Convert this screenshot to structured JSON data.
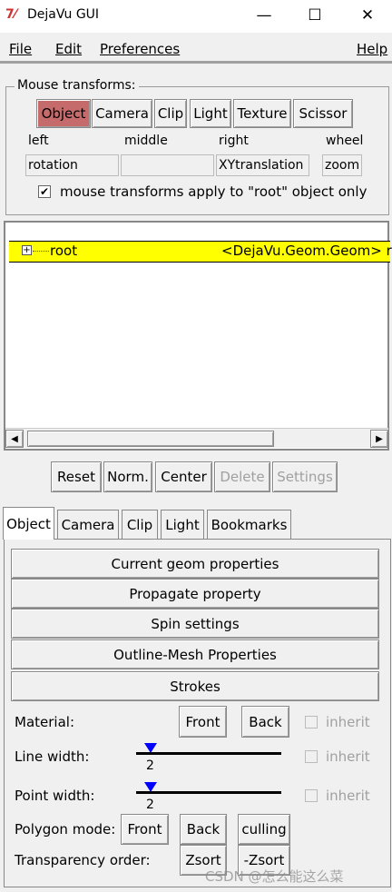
{
  "window": {
    "title": "DejaVu GUI",
    "icon": "tk-feather-icon"
  },
  "menubar": {
    "file": "File",
    "edit": "Edit",
    "preferences": "Preferences",
    "help": "Help"
  },
  "mouse_transforms": {
    "legend": "Mouse transforms:",
    "buttons": [
      "Object",
      "Camera",
      "Clip",
      "Light",
      "Texture",
      "Scissor"
    ],
    "selected": "Object",
    "headers": {
      "left": "left",
      "middle": "middle",
      "right": "right",
      "wheel": "wheel"
    },
    "values": {
      "left": "rotation",
      "middle": "",
      "right": "XYtranslation",
      "wheel": "zoom"
    },
    "root_only_label": "mouse transforms apply to \"root\" object only",
    "root_only_checked": true
  },
  "tree": {
    "node_name": "root",
    "node_type": "<DejaVu.Geom.Geom> r",
    "expand_glyph": "+"
  },
  "actions": {
    "reset": "Reset",
    "norm": "Norm.",
    "center": "Center",
    "delete": "Delete",
    "settings": "Settings"
  },
  "tabs": [
    "Object",
    "Camera",
    "Clip",
    "Light",
    "Bookmarks"
  ],
  "active_tab": "Object",
  "panel": {
    "sections": [
      "Current geom properties",
      "Propagate property",
      "Spin settings",
      "Outline-Mesh Properties",
      "Strokes"
    ],
    "material_label": "Material:",
    "front": "Front",
    "back": "Back",
    "inherit": "inherit",
    "line_width_label": "Line width:",
    "line_width_value": "2",
    "point_width_label": "Point width:",
    "point_width_value": "2",
    "polygon_mode_label": "Polygon mode:",
    "polygon_front": "Front",
    "polygon_back": "Back",
    "culling": "culling",
    "transparency_label": "Transparency order:",
    "zsort": "Zsort",
    "neg_zsort": "-Zsort"
  },
  "watermark": "CSDN @怎么能这么菜"
}
